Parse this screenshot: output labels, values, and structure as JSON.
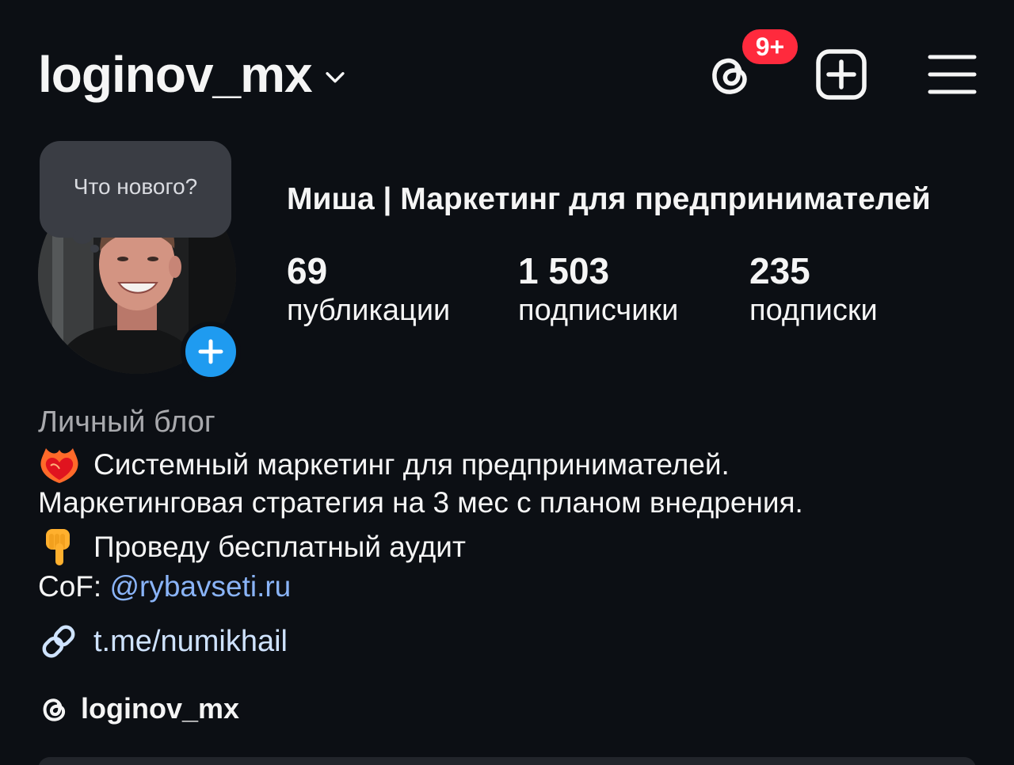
{
  "header": {
    "username": "loginov_mx",
    "threads_badge": "9+"
  },
  "profile": {
    "note_bubble": "Что нового?",
    "full_name": "Миша | Маркетинг для предпринимателей",
    "stats": [
      {
        "value": "69",
        "label": "публикации"
      },
      {
        "value": "1 503",
        "label": "подписчики"
      },
      {
        "value": "235",
        "label": "подписки"
      }
    ]
  },
  "bio": {
    "category": "Личный блог",
    "line1": "Системный маркетинг для предпринимателей.",
    "line2": "Маркетинговая стратегия на 3 мес с планом внедрения.",
    "line3": "Проведу бесплатный аудит",
    "line4_prefix": "CoF: ",
    "line4_mention": "@rybavseti.ru",
    "link": "t.me/numikhail",
    "threads_handle": "loginov_mx"
  },
  "colors": {
    "background": "#0c0f14",
    "badge": "#ff2a3d",
    "story_add": "#1f9bf0",
    "mention": "#8ab4f8",
    "category_text": "#a8a9ad"
  },
  "icons": {
    "username_chevron": "chevron-down-icon",
    "threads": "threads-icon",
    "create": "plus-square-icon",
    "menu": "hamburger-menu-icon",
    "story_add": "plus-icon",
    "bio_emoji_1": "heart-on-fire-icon",
    "bio_emoji_2": "pointing-down-hand-icon",
    "link": "link-icon",
    "threads_small": "threads-icon"
  }
}
